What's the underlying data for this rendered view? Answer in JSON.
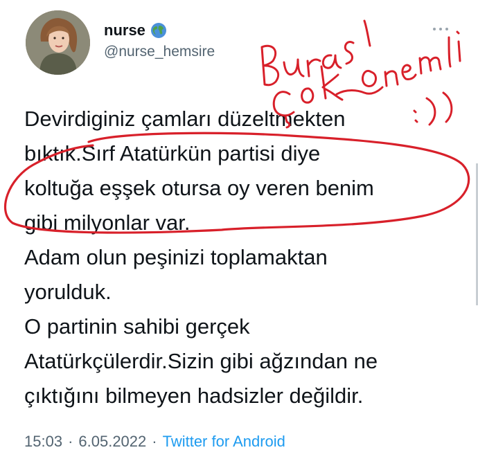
{
  "tweet": {
    "display_name": "nurse",
    "handle": "@nurse_hemsire",
    "badge_icon": "globe-icon",
    "more_icon": "more-dots-icon",
    "lines": [
      "Devirdiginiz çamları düzeltmekten",
      "bıktık.Sırf Atatürkün partisi diye",
      "koltuğa eşşek otursa oy veren benim",
      "gibi milyonlar var.",
      "Adam olun peşinizi toplamaktan",
      "yorulduk.",
      "O partinin sahibi gerçek",
      "Atatürkçülerdir.Sizin gibi ağzından ne",
      "çıktığını bilmeyen hadsizler değildir."
    ],
    "time": "15:03",
    "date": "6.05.2022",
    "separator": "·",
    "source": "Twitter for Android"
  },
  "handwritten_note": "Burası Çok Önemli :))",
  "colors": {
    "text": "#0f1419",
    "secondary": "#536471",
    "link": "#1d9bf0",
    "annotation": "#d8202a"
  }
}
